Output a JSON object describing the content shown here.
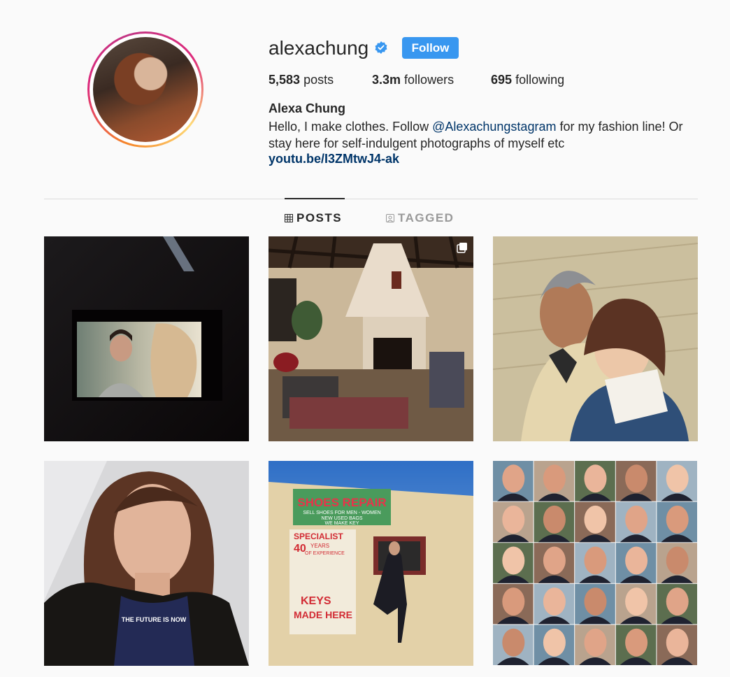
{
  "profile": {
    "username": "alexachung",
    "follow_label": "Follow",
    "stats": {
      "posts_count": "5,583",
      "posts_label": "posts",
      "followers_count": "3.3m",
      "followers_label": "followers",
      "following_count": "695",
      "following_label": "following"
    },
    "full_name": "Alexa Chung",
    "bio_part1": "Hello, I make clothes. Follow ",
    "bio_mention": "@Alexachungstagram",
    "bio_part2": " for my fashion line! Or stay here for self-indulgent photographs of myself etc",
    "link": "youtu.be/I3ZMtwJ4-ak"
  },
  "tabs": [
    {
      "label": "POSTS",
      "icon": "grid-icon",
      "active": true
    },
    {
      "label": "TAGGED",
      "icon": "tagged-icon",
      "active": false
    }
  ],
  "posts": [
    {
      "name": "post-movie-screen",
      "icon": ""
    },
    {
      "name": "post-living-room",
      "icon": "multiple-images-icon"
    },
    {
      "name": "post-selfie-netflix",
      "icon": ""
    },
    {
      "name": "post-portrait",
      "icon": ""
    },
    {
      "name": "post-shoes-repair",
      "icon": ""
    },
    {
      "name": "post-faces-collage",
      "icon": ""
    }
  ],
  "shoe_sign": {
    "title": "SHOES REPAIR",
    "line1": "SELL SHOES FOR MEN - WOMEN",
    "line2": "NEW    USED BAGS",
    "line3": "WE MAKE KEY",
    "specialist": "SPECIALIST",
    "years": "40",
    "years_text": "YEARS",
    "experience": "OF EXPERIENCE",
    "keys": "KEYS",
    "made_here": "MADE HERE"
  },
  "tshirt_text": "THE FUTURE IS NOW",
  "colors": {
    "accent": "#3897f0",
    "link": "#003569",
    "text": "#262626",
    "muted": "#999999",
    "background": "#fafafa"
  }
}
